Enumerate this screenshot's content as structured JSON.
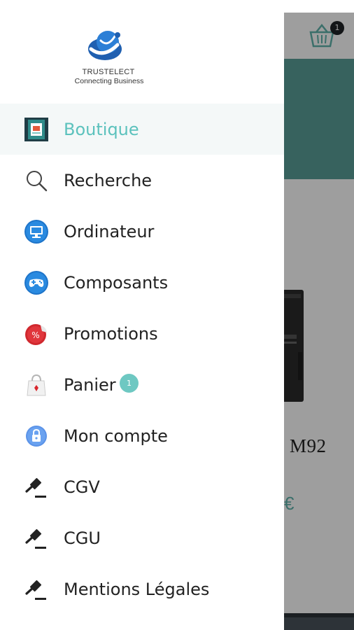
{
  "logo": {
    "name": "TRUSTELECT",
    "tagline": "Connecting Business"
  },
  "menu": [
    {
      "label": "Boutique",
      "icon": "shop-icon",
      "active": true
    },
    {
      "label": "Recherche",
      "icon": "search-icon"
    },
    {
      "label": "Ordinateur",
      "icon": "monitor-icon"
    },
    {
      "label": "Composants",
      "icon": "gamepad-icon"
    },
    {
      "label": "Promotions",
      "icon": "percent-tag-icon"
    },
    {
      "label": "Panier",
      "icon": "shopping-bag-icon",
      "badge": "1"
    },
    {
      "label": "Mon compte",
      "icon": "lock-icon"
    },
    {
      "label": "CGV",
      "icon": "gavel-icon"
    },
    {
      "label": "CGU",
      "icon": "gavel-icon"
    },
    {
      "label": "Mentions Légales",
      "icon": "gavel-icon"
    }
  ],
  "background": {
    "cart_count": "1",
    "product_name_partial": "M92",
    "price_partial": "€"
  },
  "colors": {
    "accent": "#5cc2bd",
    "banner": "#5a9e98",
    "bottom_bar": "#2d3338"
  }
}
